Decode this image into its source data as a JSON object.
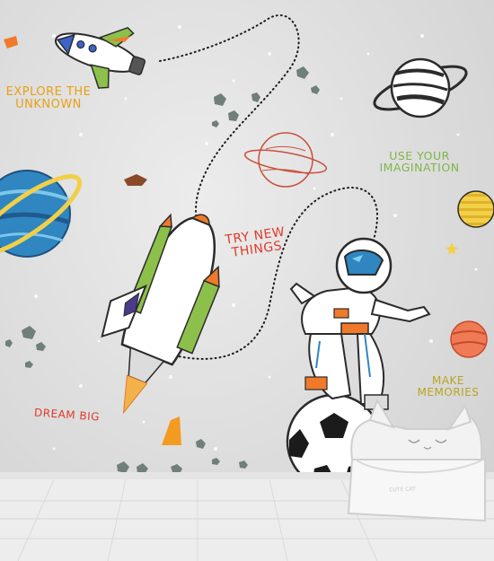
{
  "wall_texts": {
    "explore": "EXPLORE THE UNKNOWN",
    "try_new": "TRY NEW THINGS",
    "imagination": "USE YOUR IMAGINATION",
    "dream": "DREAM BIG",
    "memories": "MAKE MEMORIES"
  },
  "sofa": {
    "label": "CUTE CAT"
  },
  "colors": {
    "wall": "#dcdcdc",
    "floor": "#ededed",
    "explore_text": "#e8a114",
    "try_text": "#e03a2a",
    "imagination_text": "#7fb54a",
    "dream_text": "#e03a2a",
    "memories_text": "#b7a51f",
    "planet_blue": "#2f86c0",
    "rocket_green": "#8cc04a",
    "rocket_orange": "#f07a2a"
  }
}
